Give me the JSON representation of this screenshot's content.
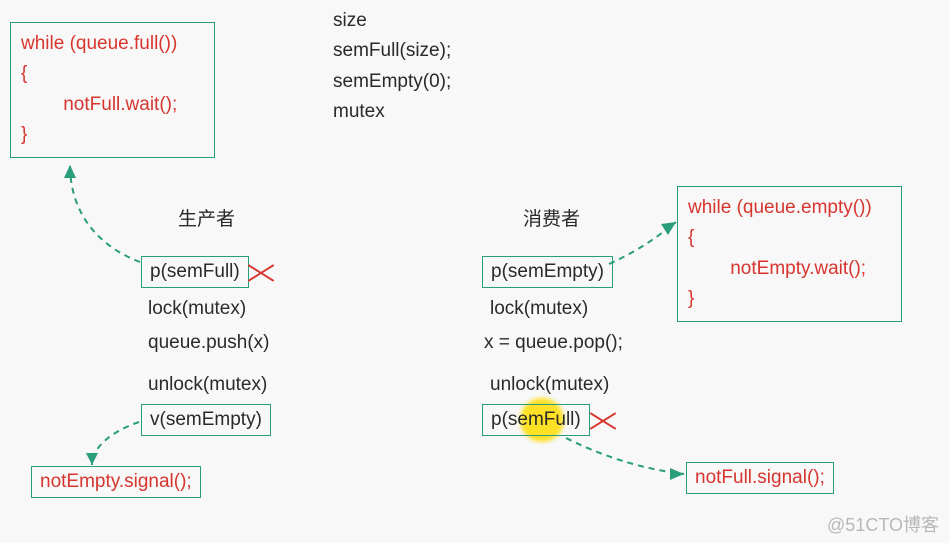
{
  "init": {
    "l1": "size",
    "l2": "semFull(size);",
    "l3": "semEmpty(0);",
    "l4": "mutex"
  },
  "box_while_full": {
    "l1": "while (queue.full())",
    "l2": "{",
    "l3": "        notFull.wait();",
    "l4": "}"
  },
  "box_while_empty": {
    "l1": "while (queue.empty())",
    "l2": "{",
    "l3": "        notEmpty.wait();",
    "l4": "}"
  },
  "producer": {
    "heading": "生产者",
    "p_semfull": "p(semFull)",
    "lock": "lock(mutex)",
    "push": "queue.push(x)",
    "unlock": "unlock(mutex)",
    "v_semempty": "v(semEmpty)"
  },
  "consumer": {
    "heading": "消费者",
    "p_semempty": "p(semEmpty)",
    "lock": "lock(mutex)",
    "pop": "x = queue.pop();",
    "unlock": "unlock(mutex)",
    "p_semfull": "p(semFull)"
  },
  "signal_notempty": "notEmpty.signal();",
  "signal_notfull": "notFull.signal();",
  "watermark": "@51CTO博客"
}
